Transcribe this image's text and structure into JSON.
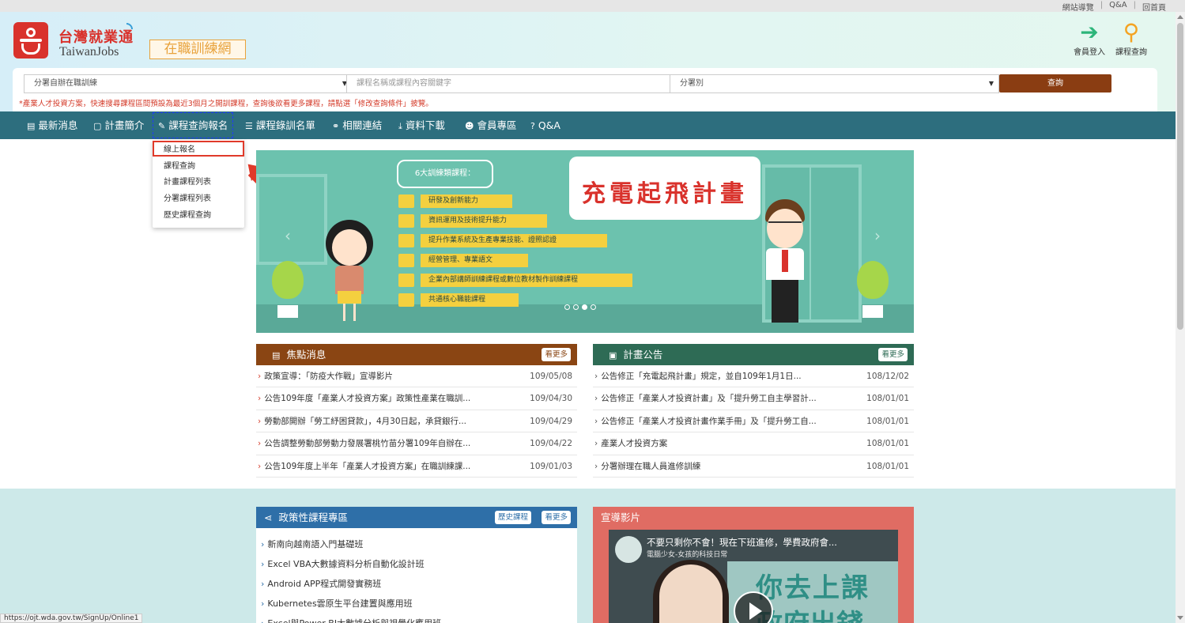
{
  "util_links": [
    "網站導覽",
    "Q&A",
    "回首頁"
  ],
  "brand": {
    "zh": "台灣就業通",
    "en": "TaiwanJobs",
    "sub": "在職訓練網",
    "color": "#d9322c"
  },
  "header_icons": {
    "login": "會員登入",
    "search": "課程查詢"
  },
  "search": {
    "dept_value": "分署自辦在職訓練",
    "keyword_placeholder": "課程名稱或課程內容關鍵字",
    "branch_value": "分署別",
    "query_button": "查詢",
    "notice": "*產業人才投資方案，快速搜尋課程區間預設為最近3個月之開訓課程，查詢後欲看更多課程，請點選「修改查詢條件」披覽。"
  },
  "nav": {
    "items": [
      "最新消息",
      "計畫簡介",
      "課程查詢報名",
      "課程錄訓名單",
      "相關連結",
      "資料下載",
      "會員專區",
      "Q&A"
    ],
    "dropdown": [
      "線上報名",
      "課程查詢",
      "計畫課程列表",
      "分署課程列表",
      "歷史課程查詢"
    ]
  },
  "banner": {
    "tag": "6大訓練類課程：",
    "items": [
      "研發及創新能力",
      "資訊運用及技術提升能力",
      "提升作業系統及生產專業技能、證照認證",
      "經營管理、專業語文",
      "企業內部講師訓練課程或數位教材製作訓練課程",
      "共通核心職能課程"
    ],
    "title": "充電起飛計畫",
    "active_slide": 3,
    "slide_count": 4
  },
  "focus_news": {
    "title": "焦點消息",
    "more": "看更多",
    "rows": [
      {
        "text": "政策宣導：「防疫大作戰」宣導影片",
        "date": "109/05/08"
      },
      {
        "text": "公告109年度「產業人才投資方案」政策性產業在職訓...",
        "date": "109/04/30"
      },
      {
        "text": "勞動部開辦「勞工紓困貸款」，4月30日起，承貸銀行...",
        "date": "109/04/29"
      },
      {
        "text": "公告調整勞動部勞動力發展署桃竹苗分署109年自辦在...",
        "date": "109/04/22"
      },
      {
        "text": "公告109年度上半年「產業人才投資方案」在職訓練課...",
        "date": "109/01/03"
      }
    ]
  },
  "plan_news": {
    "title": "計畫公告",
    "more": "看更多",
    "rows": [
      {
        "text": "公告修正「充電起飛計畫」規定，並自109年1月1日...",
        "date": "108/12/02"
      },
      {
        "text": "公告修正「產業人才投資計畫」及「提升勞工自主學習計...",
        "date": "108/01/01"
      },
      {
        "text": "公告修正「產業人才投資計畫作業手冊」及「提升勞工自...",
        "date": "108/01/01"
      },
      {
        "text": "產業人才投資方案",
        "date": "108/01/01"
      },
      {
        "text": "分署辦理在職人員進修訓練",
        "date": "108/01/01"
      }
    ]
  },
  "policy": {
    "title": "政策性課程專區",
    "history": "歷史課程",
    "more": "看更多",
    "items": [
      "新南向越南語入門基礎班",
      "Excel VBA大數據資料分析自動化設計班",
      "Android APP程式開發實務班",
      "Kubernetes雲原生平台建置與應用班",
      "Excel與Power BI大數據分析與視覺化應用班"
    ]
  },
  "video": {
    "title": "宣導影片",
    "video_title": "不要只剩你不會！現在下班進修，學費政府會...",
    "channel": "電腦少女-女孩的科技日常",
    "overlay1": "你去上課",
    "overlay2": "政府出錢"
  },
  "status_url": "https://ojt.wda.gov.tw/SignUp/Online1"
}
